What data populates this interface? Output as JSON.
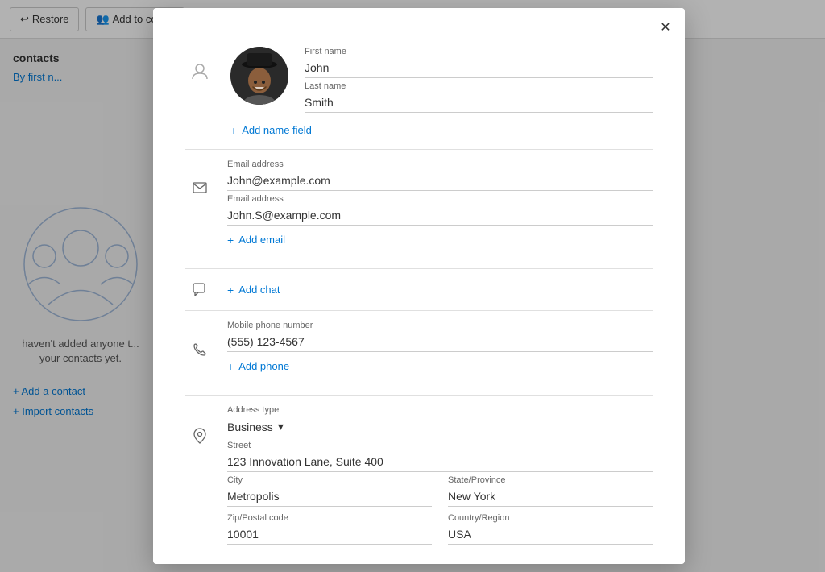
{
  "background": {
    "toolbar": {
      "restore_label": "Restore",
      "add_to_contacts_label": "Add to cont..."
    },
    "sidebar": {
      "contacts_title": "contacts",
      "sort_label": "By first n..."
    },
    "no_contacts_text": "haven't added anyone t... your contacts yet.",
    "add_contact_label": "+ Add a contact",
    "import_contacts_label": "+ Import contacts"
  },
  "modal": {
    "close_label": "✕",
    "avatar_alt": "John Smith photo",
    "first_name": {
      "label": "First name",
      "value": "John"
    },
    "last_name": {
      "label": "Last name",
      "value": "Smith"
    },
    "add_name_field_label": "+ Add name field",
    "email_section": {
      "email1": {
        "label": "Email address",
        "value": "John@example.com"
      },
      "email2": {
        "label": "Email address",
        "value": "John.S@example.com"
      },
      "add_email_label": "+ Add email"
    },
    "chat_section": {
      "add_chat_label": "+ Add chat"
    },
    "phone_section": {
      "phone1": {
        "label": "Mobile phone number",
        "value": "(555) 123-4567"
      },
      "add_phone_label": "+ Add phone"
    },
    "address_section": {
      "address_type_label": "Address type",
      "address_type_value": "Business",
      "street_label": "Street",
      "street_value": "123 Innovation Lane, Suite 400",
      "city_label": "City",
      "city_value": "Metropolis",
      "state_label": "State/Province",
      "state_value": "New York",
      "zip_label": "Zip/Postal code",
      "zip_value": "10001",
      "country_label": "Country/Region",
      "country_value": "USA"
    }
  },
  "icons": {
    "close": "✕",
    "person": "👤",
    "email": "✉",
    "chat": "💬",
    "phone": "📞",
    "location": "📍",
    "restore": "↩",
    "add_contact_icon": "👥",
    "plus": "+"
  }
}
